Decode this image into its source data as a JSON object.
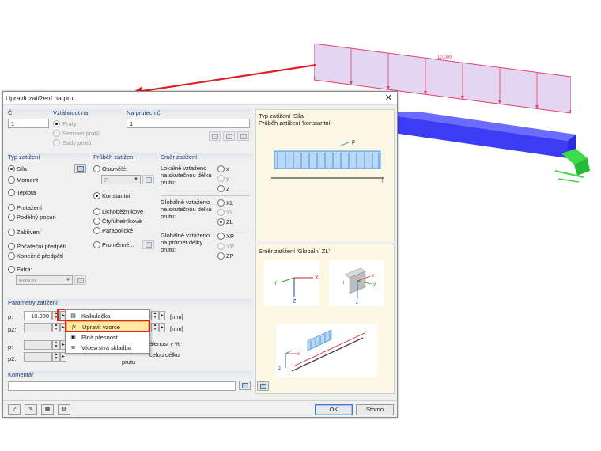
{
  "scene": {
    "load_value_label": "10.000",
    "colors": {
      "load_fill": "#e4d6f2",
      "load_line": "#e0406a",
      "beam": "#4a4aff",
      "support": "#3fdc4a",
      "arrow": "#e02020"
    }
  },
  "dialog": {
    "title": "Upravit zatížení na prut",
    "close_icon": "close-icon",
    "number": {
      "label": "Č.",
      "value": "1"
    },
    "relative_to": {
      "label": "Vztáhnout na",
      "options": [
        {
          "label": "Pruty",
          "selected": true,
          "enabled": false
        },
        {
          "label": "Seznam prutů",
          "selected": false,
          "enabled": false
        },
        {
          "label": "Sady prutů",
          "selected": false,
          "enabled": false
        }
      ]
    },
    "on_members": {
      "label": "Na prutech č.",
      "value": "1"
    },
    "load_type": {
      "label": "Typ zatížení",
      "options": [
        {
          "label": "Síla",
          "selected": true
        },
        {
          "label": "Moment",
          "selected": false
        },
        {
          "label": "Teplota",
          "selected": false
        },
        {
          "label": "Protažení",
          "selected": false
        },
        {
          "label": "Podélný posun",
          "selected": false
        },
        {
          "label": "Zakřivení",
          "selected": false
        },
        {
          "label": "Počáteční předpětí",
          "selected": false
        },
        {
          "label": "Konečné předpětí",
          "selected": false
        },
        {
          "label": "Extra:",
          "selected": false
        }
      ],
      "extra_value": "Posun"
    },
    "load_distribution": {
      "label": "Průběh zatížení",
      "options": [
        {
          "label": "Osamělé:",
          "selected": false
        },
        {
          "label": "Konstantní",
          "selected": true
        },
        {
          "label": "Lichoběžníkové",
          "selected": false
        },
        {
          "label": "Čtyřúhelníkové",
          "selected": false
        },
        {
          "label": "Parabolické",
          "selected": false
        },
        {
          "label": "Proměnné...",
          "selected": false
        }
      ],
      "point_value": "P"
    },
    "load_direction": {
      "label": "Směr zatížení",
      "local_text": "Lokálně vztaženo na skutečnou délku prutu:",
      "local_options": [
        {
          "label": "x",
          "selected": false
        },
        {
          "label": "y",
          "selected": false
        },
        {
          "label": "z",
          "selected": false
        }
      ],
      "global_true_text": "Globálně vztaženo na skutečnou délku prutu:",
      "global_true_options": [
        {
          "label": "XL",
          "selected": false
        },
        {
          "label": "YL",
          "selected": false
        },
        {
          "label": "ZL",
          "selected": true
        }
      ],
      "global_proj_text": "Globálně vztaženo na průmět délky prutu:",
      "global_proj_options": [
        {
          "label": "XP",
          "selected": false
        },
        {
          "label": "YP",
          "selected": false
        },
        {
          "label": "ZP",
          "selected": false
        }
      ]
    },
    "parameters": {
      "label": "Parametry zatížení",
      "p_label": "p:",
      "p_value": "10.000",
      "p2_label": "p2:",
      "unit": "[mm]",
      "p_label_b": "p:",
      "p2_label_b": "p2:",
      "partial_text_1": "álenost v %",
      "partial_text_2": "celou délku",
      "partial_text_3": "prutu"
    },
    "context_menu": {
      "items": [
        {
          "label": "Kalkulačka",
          "icon": "calculator-icon"
        },
        {
          "label": "Upravit vzorce",
          "icon": "formula-icon",
          "highlighted": true
        },
        {
          "label": "Plná přesnost",
          "icon": "precision-icon"
        },
        {
          "label": "Vícevrstvá skladba",
          "icon": "layers-icon"
        }
      ]
    },
    "comment": {
      "label": "Komentář",
      "value": ""
    },
    "right_top": {
      "line1": "Typ zatížení 'Síla'",
      "line2": "Průběh zatížení 'konstantní'",
      "diagram_p": "p",
      "diagram_i": "i",
      "diagram_j": "j"
    },
    "right_bottom": {
      "title": "Směr zatížení 'Globální ZL'",
      "axis_x": "X",
      "axis_y": "Y",
      "axis_z": "Z",
      "small_x": "x",
      "small_y": "y",
      "small_z": "z",
      "small_i": "i",
      "small_j": "j"
    },
    "ok_label": "OK",
    "cancel_label": "Storno",
    "footer_icons": [
      "help-icon",
      "edit-icon",
      "units-icon",
      "settings-icon"
    ]
  }
}
